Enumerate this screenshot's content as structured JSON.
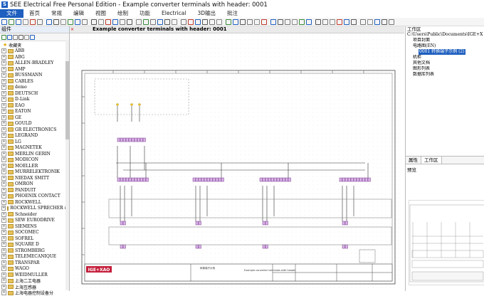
{
  "window": {
    "title": "SEE Electrical Free Personal Edition - Example converter terminals with header: 0001"
  },
  "ribbon": {
    "tabs": [
      "文件",
      "首页",
      "常规",
      "编辑",
      "视图",
      "绘制",
      "功能",
      "Electrical",
      "3D输出",
      "批注"
    ]
  },
  "left_panel": {
    "title": "组件",
    "favorites": "收藏夹",
    "items": [
      "ABB",
      "ABG",
      "ALLEN-BRADLEY",
      "AMP",
      "BUSSMANN",
      "CABLES",
      "demo",
      "DEUTSCH",
      "D-Link",
      "EAO",
      "EATON",
      "GE",
      "GOULD",
      "GR ELECTRONICS",
      "LEGRAND",
      "LG",
      "MAGNETEK",
      "MERLIN GERIN",
      "MODICON",
      "MOELLER",
      "MURRELEKTRONIK",
      "NIEDAX SMITT",
      "OMRON",
      "PANDUIT",
      "PHOENIX CONTACT",
      "ROCKWELL",
      "ROCKWELL SPRECHER &amp;",
      "Schneider",
      "SEW EURODRIVE",
      "SIEMENS",
      "SOCOMEC",
      "SOFREL",
      "SQUARE D",
      "STROMBERG",
      "TELEMECANIQUE",
      "TRANSPAR",
      "WAGO",
      "WEIDMULLER",
      "上海二工电器",
      "上海互感器",
      "上海电器控制设备分"
    ]
  },
  "document": {
    "tab_label": "Example converter terminals with header: 0001"
  },
  "right_panel": {
    "title": "工作区",
    "path": "C:\\Users\\Public\\Documents\\IGE+X",
    "tree": [
      "项目封面",
      "电路图(EN)",
      "0001 转换端子示例 (2)",
      "机柜",
      "其他文档",
      "图形列表",
      "数据库列表"
    ],
    "tabs": [
      "属性",
      "工作区"
    ],
    "preview_label": "预览"
  },
  "titleblock": {
    "logo": "IGE+XAO",
    "drawing_name": "转换端子示例",
    "drawing_title": "Example converter terminals with header"
  },
  "colors": {
    "accent": "#1f5fbf"
  }
}
